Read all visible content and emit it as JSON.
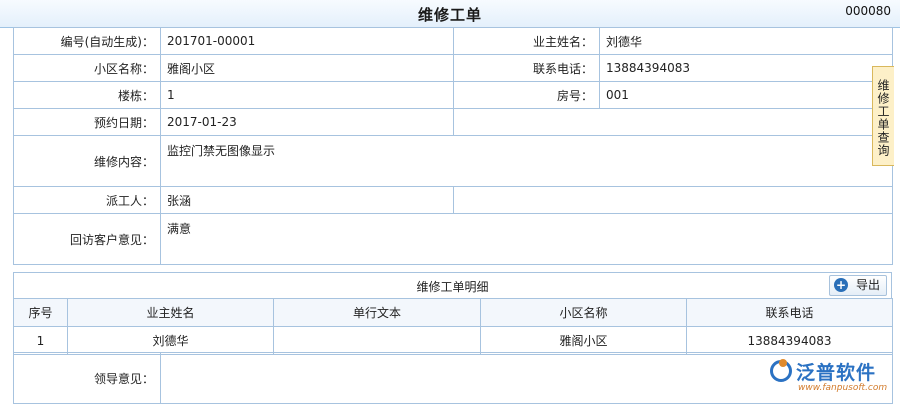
{
  "header": {
    "title": "维修工单",
    "code": "000080"
  },
  "form": {
    "order_no_label": "编号(自动生成)：",
    "order_no": "201701-00001",
    "owner_label": "业主姓名：",
    "owner": "刘德华",
    "community_label": "小区名称：",
    "community": "雅阁小区",
    "phone_label": "联系电话：",
    "phone": "13884394083",
    "building_label": "楼栋：",
    "building": "1",
    "room_label": "房号：",
    "room": "001",
    "date_label": "预约日期：",
    "date": "2017-01-23",
    "content_label": "维修内容：",
    "content": "监控门禁无图像显示",
    "worker_label": "派工人：",
    "worker": "张涵",
    "feedback_label": "回访客户意见：",
    "feedback": "满意"
  },
  "detail": {
    "title": "维修工单明细",
    "export_label": "导出",
    "columns": [
      "序号",
      "业主姓名",
      "单行文本",
      "小区名称",
      "联系电话"
    ],
    "rows": [
      [
        "1",
        "刘德华",
        "",
        "雅阁小区",
        "13884394083"
      ]
    ]
  },
  "leader": {
    "label": "领导意见：",
    "value": ""
  },
  "side_tab": {
    "label": "维修工单查询"
  },
  "watermark": {
    "name": "泛普软件",
    "url": "www.fanpusoft.com"
  },
  "colors": {
    "border": "#a7c3df",
    "header_bg": "#e4f0fb",
    "tab_bg": "#fdf0c8",
    "brand": "#2b72c3"
  }
}
